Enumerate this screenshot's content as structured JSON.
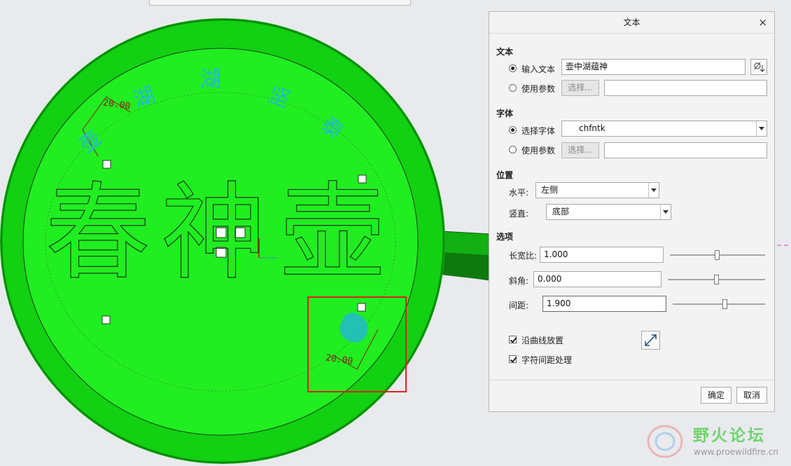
{
  "model_view": {
    "model_texts": {
      "arc_top": [
        "壶",
        "湖",
        "湖",
        "坚",
        "泰"
      ],
      "center": [
        "春",
        "神",
        "壶"
      ],
      "dims": {
        "top_left": "20.00",
        "bottom_right": "20.00"
      }
    },
    "colors": {
      "body": "#19ec19",
      "text_cyan": "#25b9cf",
      "highlight_box": "#e02020",
      "dimension": "#8b1a1a"
    }
  },
  "dialog": {
    "title": "文本",
    "close_glyph": "×",
    "text_section": {
      "heading": "文本",
      "input_text_label": "输入文本",
      "input_text_value": "壶中湖蕴神",
      "use_param_label": "使用参数",
      "select_button": "选择...",
      "param_value": ""
    },
    "font_section": {
      "heading": "字体",
      "select_font_label": "选择字体",
      "font_value": "chfntk",
      "use_param_label": "使用参数",
      "select_button": "选择...",
      "param_value": ""
    },
    "position_section": {
      "heading": "位置",
      "horizontal_label": "水平:",
      "horizontal_value": "左侧",
      "vertical_label": "竖直:",
      "vertical_value": "底部"
    },
    "options_section": {
      "heading": "选项",
      "aspect_label": "长宽比:",
      "aspect_value": "1.000",
      "slant_label": "斜角:",
      "slant_value": "0.000",
      "spacing_label": "间距:",
      "spacing_value": "1.900",
      "along_curve_label": "沿曲线放置",
      "along_curve_checked": true,
      "char_spacing_label": "字符间距处理",
      "char_spacing_checked": true
    },
    "buttons": {
      "ok": "确定",
      "cancel": "取消"
    }
  },
  "watermark": {
    "name": "野火论坛",
    "url": "www.proewildfire.cn"
  }
}
